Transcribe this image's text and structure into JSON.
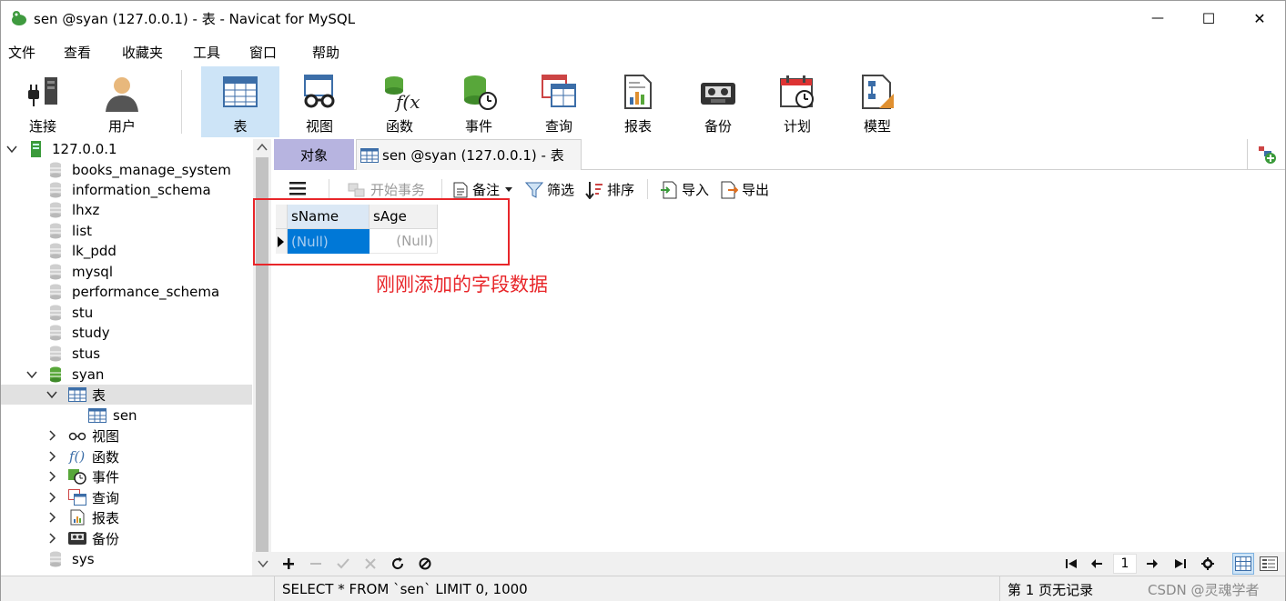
{
  "window": {
    "title": "sen @syan (127.0.0.1) - 表 - Navicat for MySQL",
    "minimize_glyph": "—",
    "maximize_glyph": "☐",
    "close_glyph": "✕"
  },
  "menu": [
    "文件",
    "查看",
    "收藏夹",
    "工具",
    "窗口",
    "帮助"
  ],
  "toolbar": {
    "connect": "连接",
    "user": "用户",
    "table": "表",
    "view": "视图",
    "function": "函数",
    "event": "事件",
    "query": "查询",
    "report": "报表",
    "backup": "备份",
    "schedule": "计划",
    "model": "模型"
  },
  "tree": {
    "connection": "127.0.0.1",
    "databases": [
      "books_manage_system",
      "information_schema",
      "lhxz",
      "list",
      "lk_pdd",
      "mysql",
      "performance_schema",
      "stu",
      "study",
      "stus"
    ],
    "open_db": "syan",
    "tables_node": "表",
    "table_item": "sen",
    "nodes": [
      "视图",
      "函数",
      "事件",
      "查询",
      "报表",
      "备份"
    ],
    "after": "sys"
  },
  "tabs": {
    "objects": "对象",
    "table_tab": "sen @syan (127.0.0.1) - 表"
  },
  "subtoolbar": {
    "begin_transaction": "开始事务",
    "memo": "备注",
    "filter": "筛选",
    "sort": "排序",
    "import": "导入",
    "export": "导出"
  },
  "grid": {
    "columns": [
      "sName",
      "sAge"
    ],
    "rows": [
      [
        "(Null)",
        "(Null)"
      ]
    ]
  },
  "annotation": "刚刚添加的字段数据",
  "navbar": {
    "page": "1"
  },
  "status": {
    "sql": "SELECT * FROM `sen` LIMIT 0, 1000",
    "page_info": "第 1 页无记录",
    "watermark": "CSDN @灵魂学者"
  },
  "colors": {
    "accent_selected": "#cde4f7",
    "objects_tab": "#b7b4e0",
    "cell_selected": "#0078d7",
    "annotation_red": "#e8262a",
    "db_green": "#58a73a"
  }
}
